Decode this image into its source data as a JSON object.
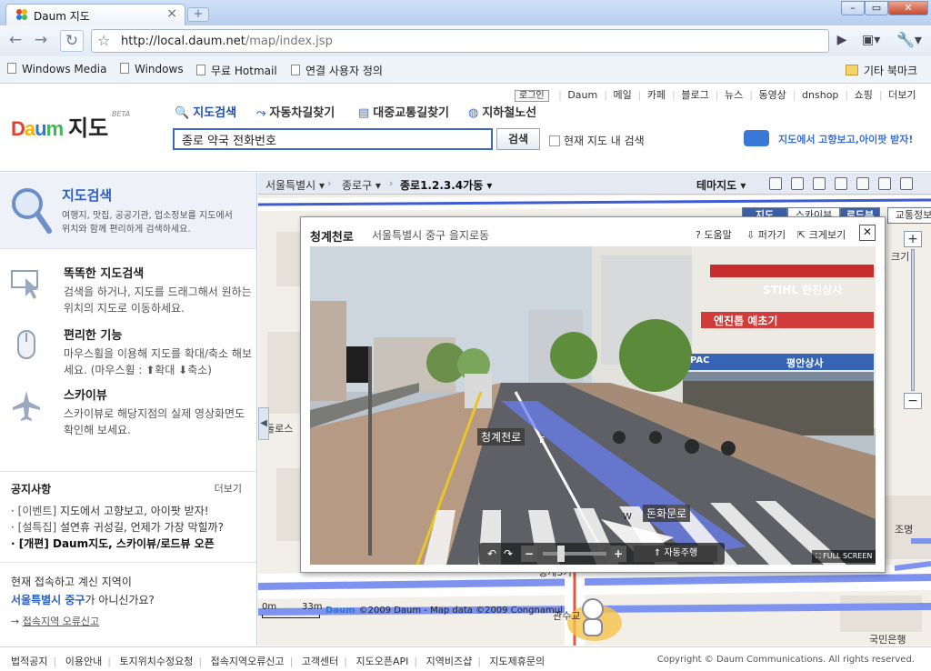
{
  "browser": {
    "tab_title": "Daum 지도",
    "tab_close": "×",
    "new_tab": "+",
    "url_host": "http://local.daum.net",
    "url_path": "/map/index.jsp",
    "back": "←",
    "forward": "→",
    "reload": "↻",
    "bookmark_star": "☆",
    "go": "▶",
    "page_menu": "▣▾",
    "tools_menu": "🔧▾",
    "window_min": "–",
    "window_max": "▭",
    "window_close": "✕",
    "bookmarks": [
      {
        "label": "Windows Media"
      },
      {
        "label": "Windows"
      },
      {
        "label": "무료 Hotmail"
      },
      {
        "label": "연결 사용자 정의"
      }
    ],
    "other_bookmarks": "기타 북마크"
  },
  "header": {
    "logo_daum": "Daum",
    "logo_title": "지도",
    "logo_beta": "BETA",
    "login": "로그인",
    "topnav": [
      "Daum",
      "메일",
      "카페",
      "블로그",
      "뉴스",
      "동영상",
      "dnshop",
      "쇼핑",
      "더보기"
    ],
    "tabs": {
      "search": "지도검색",
      "car": "자동차길찾기",
      "transit": "대중교통길찾기",
      "subway": "지하철노선"
    },
    "search_value": "종로 약국 전화번호",
    "search_button": "검색",
    "within_map": "현재 지도 내 검색",
    "promo": "지도에서 고향보고,아이팟 받자!"
  },
  "left": {
    "hero_title": "지도검색",
    "hero_desc": "여행지, 맛집, 공공기관, 업소정보를 지도에서 위치와 함께 편리하게 검색하세요.",
    "features": [
      {
        "title": "똑똑한 지도검색",
        "desc": "검색을 하거나, 지도를 드래그해서 원하는 위치의 지도로 이동하세요."
      },
      {
        "title": "편리한 기능",
        "desc": "마우스휠을 이용해 지도를 확대/축소 해보세요. (마우스휠 : ⬆확대 ⬇축소)"
      },
      {
        "title": "스카이뷰",
        "desc": "스카이뷰로 해당지점의 실제 영상화면도 확인해 보세요."
      }
    ],
    "notice_title": "공지사항",
    "notice_more": "더보기",
    "notices": [
      {
        "tag": "[이벤트]",
        "text": "지도에서 고향보고, 아이팟 받자!"
      },
      {
        "tag": "[설특집]",
        "text": "설연휴 귀성길, 언제가 가장 막힐까?"
      },
      {
        "tag": "[개편]",
        "text": "Daum지도, 스카이뷰/로드뷰 오픈"
      }
    ],
    "region_line1": "현재 접속하고 계신 지역이",
    "region_name": "서울특별시 중구",
    "region_suffix": "가 아니신가요?",
    "region_link": "접속지역 오류신고"
  },
  "map": {
    "crumbs": [
      "서울특별시 ▾",
      "종로구 ▾",
      "종로1.2.3.4가동 ▾"
    ],
    "theme_map": "테마지도 ▾",
    "view_tabs": [
      "지도",
      "스카이뷰",
      "로드뷰",
      "교통정보"
    ],
    "zoom_plus": "+",
    "zoom_minus": "−",
    "zoom_partial_label": "크기",
    "collapse": "◀",
    "road_labels": [
      "청계3가",
      "관수교",
      "돈화문로",
      "둘로스",
      "조명",
      "국민은행"
    ],
    "scale_start": "0m",
    "scale_end": "33m",
    "copyright": "©2009 Daum - Map data ©2009 Congnamul"
  },
  "roadview": {
    "title": "청계천로",
    "address": "서울특별시 중구 을지로동",
    "help": "? 도움말",
    "open": "⇩ 퍼가기",
    "enlarge": "⇱ 크게보기",
    "close": "✕",
    "labels": [
      "청계천로",
      "돈화문로"
    ],
    "compass": [
      "E",
      "W"
    ],
    "signs": [
      "STIHL 한진상사",
      "엔진톱 예초기",
      "평안상사",
      "PAC"
    ],
    "controls": {
      "rot_left": "↶",
      "rot_right": "↷",
      "minus": "−",
      "plus": "+",
      "auto": "⇑ 자동주행",
      "fullscreen": "⛶ FULL SCREEN"
    }
  },
  "footer": {
    "links": [
      "법적공지",
      "이용안내",
      "토지위치수정요청",
      "접속지역오류신고",
      "고객센터",
      "지도오픈API",
      "지역비즈샵",
      "지도제휴문의"
    ],
    "copyright": "Copyright © Daum Communications. All rights reserved."
  },
  "colors": {
    "accent_blue": "#2a5fc4",
    "roadview_route": "#6a7ef0",
    "map_bg": "#f2efe9"
  }
}
